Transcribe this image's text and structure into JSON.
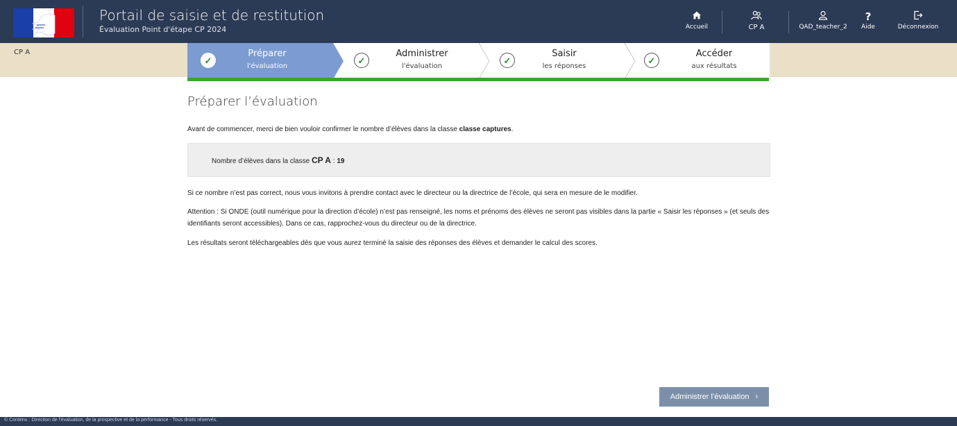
{
  "header": {
    "app_title": "Portail de saisie et de restitution",
    "app_subtitle": "Évaluation Point d'étape CP 2024",
    "nav": {
      "home": {
        "label": "Accueil",
        "icon": "home-icon"
      },
      "class": {
        "label": "CP A",
        "icon": "users-icon"
      },
      "user": {
        "label": "QAD_teacher_2",
        "icon": "user-icon"
      },
      "help": {
        "label": "Aide",
        "icon": "help-icon"
      },
      "logout": {
        "label": "Déconnexion",
        "icon": "logout-icon"
      }
    }
  },
  "bandeau": {
    "class_name": "CP A"
  },
  "steps": [
    {
      "title": "Préparer",
      "subtitle": "l'évaluation",
      "active": true
    },
    {
      "title": "Administrer",
      "subtitle": "l'évaluation",
      "active": false
    },
    {
      "title": "Saisir",
      "subtitle": "les réponses",
      "active": false
    },
    {
      "title": "Accéder",
      "subtitle": "aux résultats",
      "active": false
    }
  ],
  "main": {
    "title": "Préparer l’évaluation",
    "intro_prefix": "Avant de commencer, merci de bien vouloir confirmer le nombre d’élèves dans la classe ",
    "intro_class": "classe captures",
    "intro_suffix": ".",
    "count_label": "Nombre d’élèves dans la classe",
    "count_class": "CP A",
    "count_sep": " : ",
    "count_value": "19",
    "para1": "Si ce nombre n’est pas correct, nous vous invitons à prendre contact avec le directeur ou la directrice de l’école, qui sera en mesure de le modifier.",
    "para2": "Attention : Si ONDE (outil numérique pour la direction d’école) n’est pas renseigné, les noms et prénoms des élèves ne seront pas visibles dans la partie « Saisir les réponses » (et seuls des identifiants seront accessibles). Dans ce cas, rapprochez-vous du directeur ou de la directrice.",
    "para3": "Les résultats seront téléchargeables dès que vous aurez terminé la saisie des réponses des élèves et demander le calcul des scores.",
    "next_button": "Administrer l’évaluation"
  },
  "footer": {
    "text": "© Contenu : Direction de l'évaluation, de la prospective et de la performance - Tous droits réservés."
  },
  "colors": {
    "header_bg": "#2b3a55",
    "bandeau_bg": "#eae0c8",
    "active_step_bg": "#7b9bd1",
    "progress_green": "#3aa531",
    "button_bg": "#7b8fa9"
  }
}
